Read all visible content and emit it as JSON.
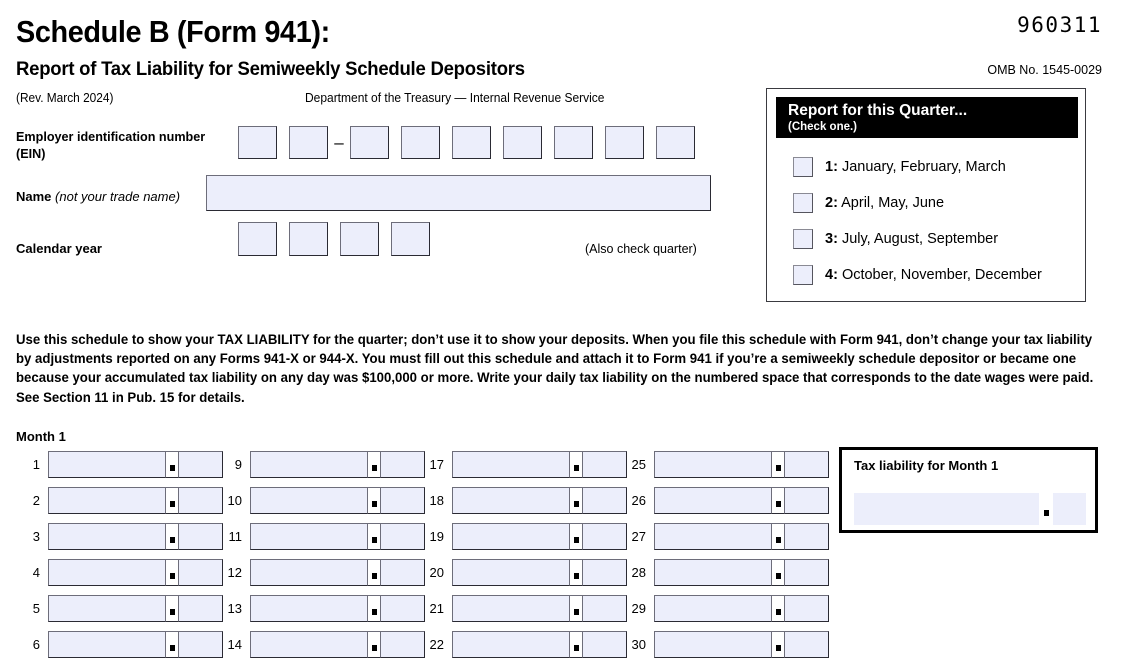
{
  "header": {
    "title": "Schedule B (Form 941):",
    "subtitle": "Report of Tax Liability for Semiweekly Schedule Depositors",
    "revision": "(Rev. March 2024)",
    "agency": "Department of the Treasury — Internal Revenue Service",
    "form_code": "960311",
    "omb": "OMB No. 1545-0029"
  },
  "identification": {
    "ein_label": "Employer identification number (EIN)",
    "ein_label_line1": "Employer identification number",
    "ein_label_line2": "(EIN)",
    "ein_separator": "–",
    "ein_boxes_before": 2,
    "ein_boxes_after": 7,
    "name_label_bold": "Name",
    "name_label_italic": "(not your trade name)",
    "name_value": "",
    "calendar_year_label": "Calendar year",
    "calendar_year_boxes": 4,
    "calendar_year_value": "",
    "also_check_quarter": "(Also check quarter)"
  },
  "quarter_panel": {
    "title": "Report for this Quarter...",
    "subtitle": "(Check one.)",
    "options": [
      {
        "num": "1:",
        "label": "January, February, March",
        "checked": false
      },
      {
        "num": "2:",
        "label": "April, May, June",
        "checked": false
      },
      {
        "num": "3:",
        "label": "July, August, September",
        "checked": false
      },
      {
        "num": "4:",
        "label": "October, November, December",
        "checked": false
      }
    ]
  },
  "instructions": "Use this schedule to show your TAX LIABILITY for the quarter; don’t use it to show your deposits. When you file this schedule with Form 941, don’t change your tax liability by adjustments reported on any Forms 941-X or 944-X. You must fill out this schedule and attach it to Form 941 if you’re a semiweekly schedule depositor or became one because your accumulated tax liability on any day was $100,000 or more. Write your daily tax liability on the numbered space that corresponds to the date wages were paid. See Section 11 in Pub. 15 for details.",
  "month_section": {
    "label": "Month 1",
    "columns": [
      {
        "numbers": [
          "1",
          "2",
          "3",
          "4",
          "5",
          "6"
        ],
        "values": [
          "",
          "",
          "",
          "",
          "",
          ""
        ]
      },
      {
        "numbers": [
          "9",
          "10",
          "11",
          "12",
          "13",
          "14"
        ],
        "values": [
          "",
          "",
          "",
          "",
          "",
          ""
        ]
      },
      {
        "numbers": [
          "17",
          "18",
          "19",
          "20",
          "21",
          "22"
        ],
        "values": [
          "",
          "",
          "",
          "",
          "",
          ""
        ]
      },
      {
        "numbers": [
          "25",
          "26",
          "27",
          "28",
          "29",
          "30"
        ],
        "values": [
          "",
          "",
          "",
          "",
          "",
          ""
        ]
      }
    ]
  },
  "tax_liability": {
    "label": "Tax liability for Month 1",
    "value": ""
  },
  "colors": {
    "field_fill": "#eceefb",
    "field_border": "#6d6d7a",
    "header_bar": "#000000",
    "page_background": "#ffffff"
  }
}
